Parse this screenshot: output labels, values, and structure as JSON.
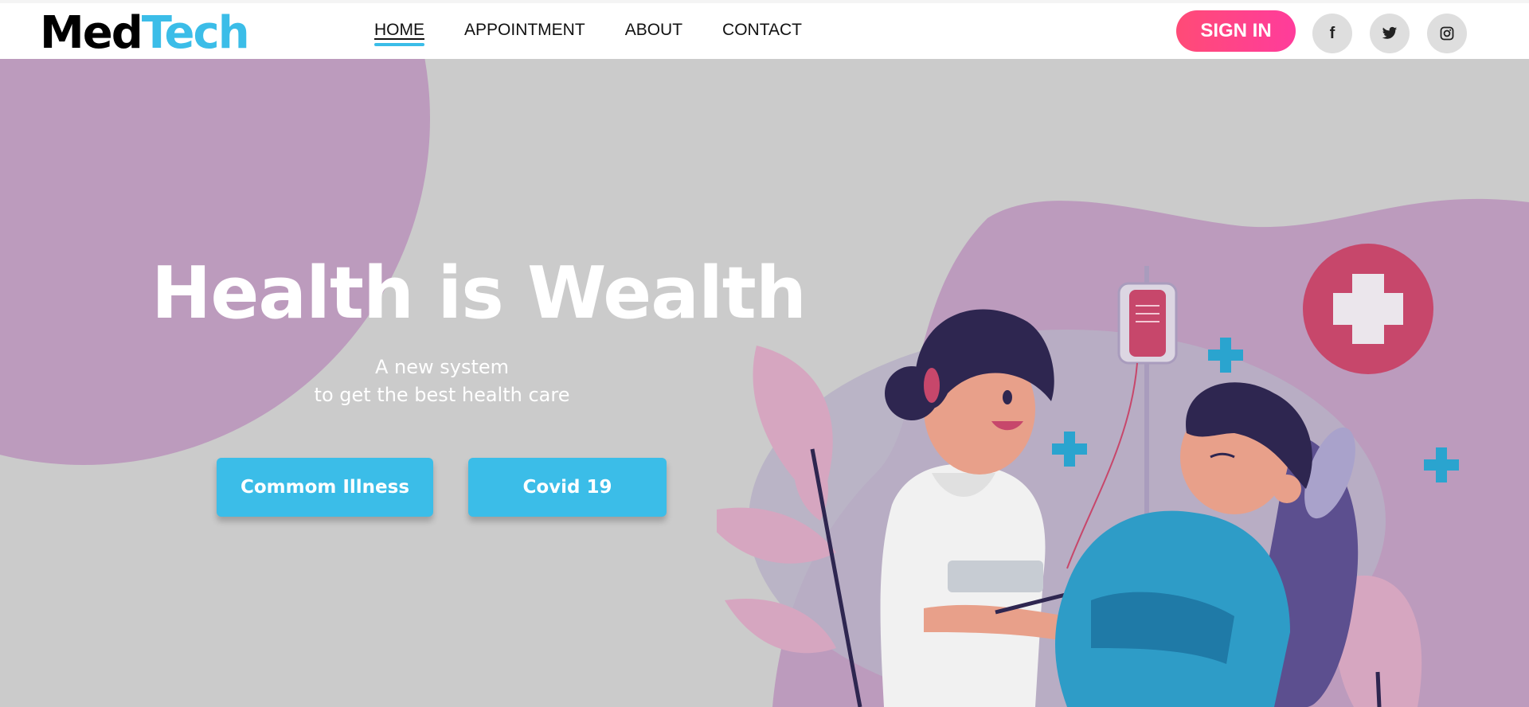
{
  "brand": {
    "part1": "Med",
    "part2": "Tech"
  },
  "nav": {
    "items": [
      {
        "label": "HOME",
        "active": true
      },
      {
        "label": "APPOINTMENT",
        "active": false
      },
      {
        "label": "ABOUT",
        "active": false
      },
      {
        "label": "CONTACT",
        "active": false
      }
    ]
  },
  "header": {
    "signin_label": "SIGN IN",
    "social": [
      {
        "icon": "facebook-icon",
        "glyph": "f"
      },
      {
        "icon": "twitter-icon"
      },
      {
        "icon": "instagram-icon"
      }
    ]
  },
  "hero": {
    "title": "Health is Wealth",
    "subtitle_line1": "A new system",
    "subtitle_line2": "to get the best health care",
    "buttons": [
      {
        "label": "Commom Illness"
      },
      {
        "label": "Covid 19"
      }
    ]
  },
  "colors": {
    "accent": "#3bbde8",
    "signin": "#ff4b77",
    "hero_bg": "#cbcbcb",
    "blob": "#bc9bbd",
    "cross": "#c7476b"
  }
}
